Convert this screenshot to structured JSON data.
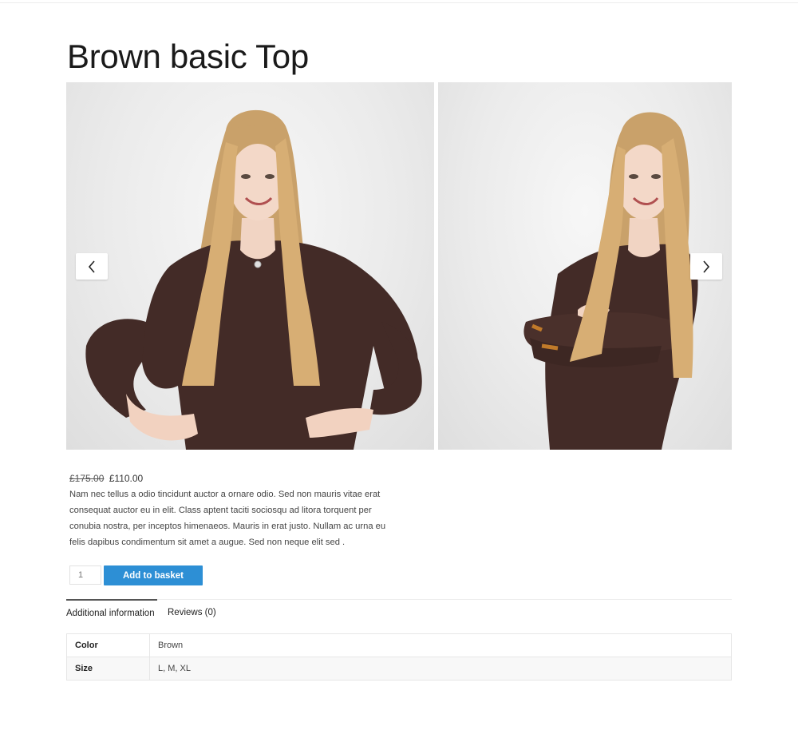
{
  "product": {
    "title": "Brown basic Top",
    "price_old": "£175.00",
    "price_new": "£110.00",
    "description": "Nam nec tellus a odio tincidunt auctor a ornare odio. Sed non mauris vitae erat consequat auctor eu in elit. Class aptent taciti sociosqu ad litora torquent per conubia nostra, per inceptos himenaeos. Mauris in erat justo. Nullam ac urna eu felis dapibus condimentum sit amet a augue. Sed non neque elit sed ."
  },
  "gallery": {
    "prev_icon": "chevron-left-icon",
    "next_icon": "chevron-right-icon"
  },
  "cart": {
    "quantity": "1",
    "add_label": "Add to basket",
    "button_color": "#2d8fd5"
  },
  "tabs": [
    {
      "label": "Additional information",
      "active": true
    },
    {
      "label": "Reviews (0)",
      "active": false
    }
  ],
  "attributes": [
    {
      "name": "Color",
      "value": "Brown"
    },
    {
      "name": "Size",
      "value": "L, M, XL"
    }
  ]
}
